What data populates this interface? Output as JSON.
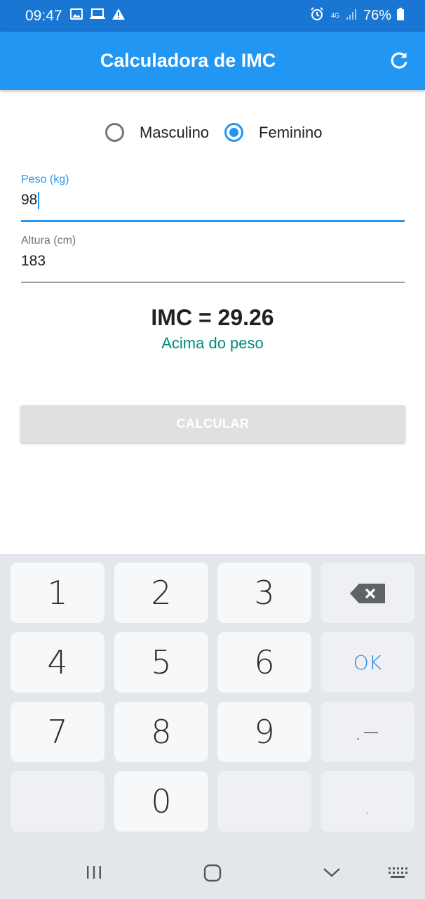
{
  "status_bar": {
    "time": "09:47",
    "battery": "76%",
    "network_type": "4G",
    "left_icons": [
      "image-icon",
      "laptop-icon",
      "warning-icon"
    ],
    "right_icons": [
      "alarm-icon",
      "signal-icon",
      "battery-icon"
    ]
  },
  "app_bar": {
    "title": "Calculadora de IMC",
    "action_icon": "refresh-icon"
  },
  "gender": {
    "options": [
      {
        "label": "Masculino",
        "selected": false
      },
      {
        "label": "Feminino",
        "selected": true
      }
    ]
  },
  "fields": {
    "weight": {
      "label": "Peso (kg)",
      "value": "98",
      "focused": true
    },
    "height": {
      "label": "Altura (cm)",
      "value": "183",
      "focused": false
    }
  },
  "result": {
    "imc_text": "IMC = 29.26",
    "status": "Acima do peso"
  },
  "calculate_button": {
    "label": "CALCULAR",
    "enabled": false
  },
  "keyboard": {
    "keys": [
      "1",
      "2",
      "3",
      "⌫",
      "4",
      "5",
      "6",
      "OK",
      "7",
      "8",
      "9",
      ".−",
      "",
      "0",
      "",
      ","
    ]
  },
  "colors": {
    "status_bar": "#1976d2",
    "app_bar": "#2196f3",
    "accent": "#2196f3",
    "result_status": "#00897b",
    "button_disabled": "#e0e0e0"
  }
}
